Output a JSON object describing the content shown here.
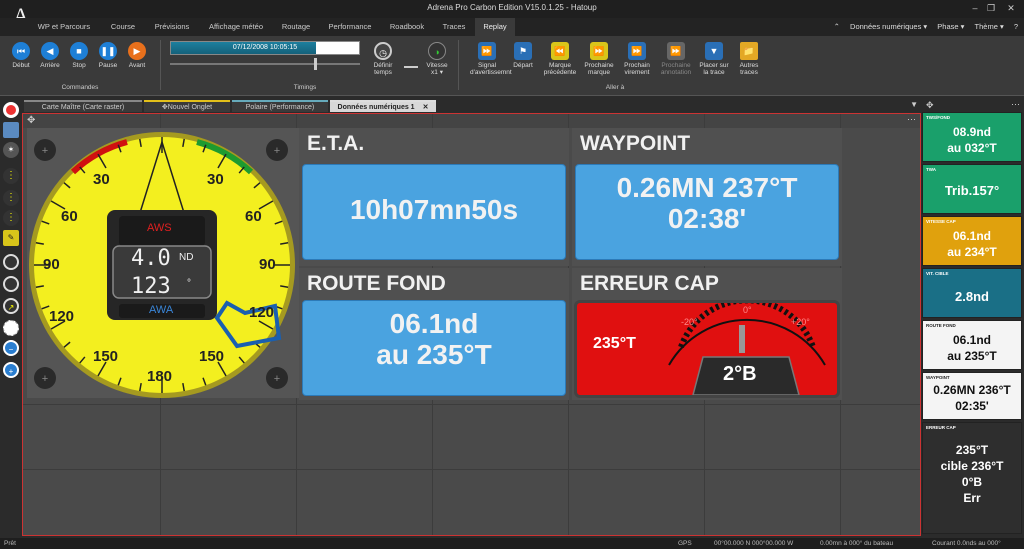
{
  "app": {
    "title": "Adrena Pro Carbon Edition V15.0.1.25 - Hatoup",
    "logo": "A",
    "window_controls": {
      "minimize": "–",
      "restore": "❐",
      "close": "✕"
    }
  },
  "menu_tabs": [
    "WP et Parcours",
    "Course",
    "Prévisions",
    "Affichage météo",
    "Routage",
    "Performance",
    "Roadbook",
    "Traces",
    "Replay"
  ],
  "right_menus": [
    "Données numériques",
    "Phase",
    "Thème",
    "?"
  ],
  "ribbon": {
    "commandes": {
      "label": "Commandes",
      "buttons": [
        "Début",
        "Arrière",
        "Stop",
        "Pause",
        "Avant"
      ]
    },
    "timings": {
      "label": "Timings",
      "datetime": "07/12/2008 10:05:15",
      "progress": 0.77,
      "define_time": "Définir temps",
      "speed_label": "Vitesse",
      "speed_value": "x1"
    },
    "aller_a": {
      "label": "Aller à",
      "buttons": [
        "Signal d'avertissemnt",
        "Départ",
        "Marque précédente",
        "Prochaine marque",
        "Prochain virement",
        "Prochaine annotation",
        "Placer sur la trace",
        "Autres traces"
      ]
    }
  },
  "doc_tabs": [
    "Carte Maître (Carte raster)",
    "Nouvel Onglet",
    "Polaire (Performance)",
    "Données numériques 1"
  ],
  "gauge": {
    "labels_top": [
      "30",
      "30"
    ],
    "labels_60": [
      "60",
      "60"
    ],
    "labels_90": [
      "90",
      "90"
    ],
    "labels_120": [
      "120",
      "120"
    ],
    "labels_150": [
      "150",
      "150"
    ],
    "label_180": "180",
    "aws_label": "AWS",
    "aws_value": "4.0",
    "aws_unit": "ND",
    "awa_label": "AWA",
    "awa_value": "123",
    "awa_unit": "°"
  },
  "panels": {
    "eta": {
      "title": "E.T.A.",
      "value": "10h07mn50s"
    },
    "waypoint": {
      "title": "WAYPOINT",
      "line1": "0.26MN 237°T",
      "line2": "02:38'"
    },
    "route_fond": {
      "title": "ROUTE FOND",
      "line1": "06.1nd",
      "line2": "au 235°T"
    },
    "erreur_cap": {
      "title": "ERREUR CAP",
      "heading": "235°T",
      "minus": "-20°",
      "zero": "0°",
      "plus": "+20°",
      "value": "2°B"
    }
  },
  "right_cards": [
    {
      "label": "TWS/FOND",
      "line1": "08.9nd",
      "line2": "au 032°T",
      "bg": "#1aa06b"
    },
    {
      "label": "TWA",
      "line1": "Trib.157°",
      "bg": "#1aa06b"
    },
    {
      "label": "VITESSE CAP",
      "line1": "06.1nd",
      "line2": "au 234°T",
      "bg": "#e0a10d"
    },
    {
      "label": "VIT. CIBLE",
      "line1": "2.8nd",
      "bg": "#1a6f86"
    },
    {
      "label": "ROUTE FOND",
      "line1": "06.1nd",
      "line2": "au 235°T",
      "bg": "#f4f4f4"
    },
    {
      "label": "WAYPOINT",
      "line1": "0.26MN 236°T",
      "line2": "02:35'",
      "bg": "#f4f4f4"
    },
    {
      "label": "ERREUR CAP",
      "line1": "235°T",
      "line2": "cible 236°T",
      "line3": "0°B",
      "line4": "Err",
      "bg": "#2e2e2e"
    }
  ],
  "status": {
    "left": "Prêt",
    "gps": "GPS",
    "coords": "00°00.000 N 000°00.000 W",
    "distance": "0.00mn à 000° du bateau",
    "current": "Courant 0.0nds au 000°"
  }
}
